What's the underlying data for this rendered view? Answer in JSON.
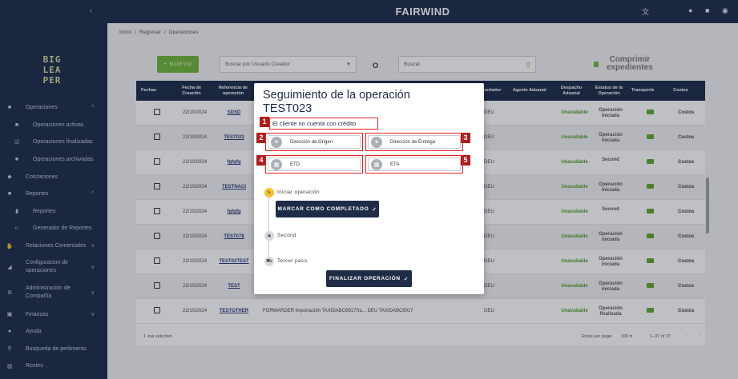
{
  "topbar": {
    "brand": "FAIRWIND",
    "icons": [
      "translate-icon",
      "bell-icon",
      "chat-icon",
      "user-account-icon"
    ]
  },
  "sidebar": {
    "logo_lines": [
      "BIG",
      "LEA",
      "PER"
    ],
    "items": [
      {
        "label": "Operaciones",
        "icon": "folder-icon",
        "chev": "^",
        "sub": false
      },
      {
        "label": "Operaciones activas",
        "icon": "info-icon",
        "sub": true
      },
      {
        "label": "Operaciones finalizadas",
        "icon": "check-box-icon",
        "sub": true
      },
      {
        "label": "Operaciones archivadas",
        "icon": "archive-icon",
        "sub": true
      },
      {
        "label": "Cotizaciones",
        "icon": "tag-icon",
        "sub": false
      },
      {
        "label": "Reportes",
        "icon": "report-icon",
        "chev": "^",
        "sub": false
      },
      {
        "label": "Reportes",
        "icon": "bar-chart-icon",
        "sub": true
      },
      {
        "label": "Generador de Reportes",
        "icon": "code-icon",
        "sub": true
      },
      {
        "label": "Relaciones Comerciales",
        "icon": "handshake-icon",
        "chev": "v",
        "sub": false
      },
      {
        "label": "Configuracion de operaciones",
        "icon": "tools-icon",
        "chev": "v",
        "sub": false,
        "two": true
      },
      {
        "label": "Administración de Compañía",
        "icon": "settings-icon",
        "chev": "v",
        "sub": false,
        "two": true
      },
      {
        "label": "Finanzas",
        "icon": "finance-icon",
        "chev": "v",
        "sub": false
      },
      {
        "label": "Ayuda",
        "icon": "help-icon",
        "sub": false
      },
      {
        "label": "Busqueda de pedimento",
        "icon": "search-icon",
        "sub": false
      },
      {
        "label": "Rostes",
        "icon": "map-icon",
        "sub": false
      }
    ]
  },
  "breadcrumb": {
    "home": "Inicio",
    "sep1": "/",
    "back": "Regresar",
    "sep2": "/",
    "current": "Operaciones"
  },
  "toolbar": {
    "new_label": "+ NUEVO",
    "user_filter_placeholder": "Buscar por Usuario Creador",
    "or_label": "O",
    "search_placeholder": "Buscar",
    "compress_label": "Comprimir expedientes"
  },
  "table": {
    "headers": [
      "Fechas",
      "Fecha de Creación",
      "Referencia de operación",
      "Exportador",
      "Agente Aduanal",
      "Despacho Aduanal",
      "Estatus de la Operación",
      "Transporte",
      "Costos"
    ],
    "rows": [
      {
        "date": "22/10/2024",
        "ref": "SDSD",
        "imp": "DEU",
        "desp": "Unavailable",
        "estado": "Operación iniciada",
        "cost": "Costos"
      },
      {
        "date": "22/10/2024",
        "ref": "TEST023",
        "imp": "DEU",
        "desp": "Unavailable",
        "estado": "Operación iniciada",
        "cost": "Costos"
      },
      {
        "date": "22/10/2024",
        "ref": "fgfgfg",
        "imp": "DEU",
        "desp": "Unavailable",
        "estado": "Second",
        "cost": "Costos"
      },
      {
        "date": "22/10/2024",
        "ref": "TESTNACI",
        "imp": "DEU",
        "desp": "Unavailable",
        "estado": "Operación iniciada",
        "cost": "Costos"
      },
      {
        "date": "22/10/2024",
        "ref": "fgfgfg",
        "imp": "DEU",
        "desp": "Unavailable",
        "estado": "Second",
        "cost": "Costos"
      },
      {
        "date": "22/10/2024",
        "ref": "TEST078",
        "imp": "DEU",
        "desp": "Unavailable",
        "estado": "Operación iniciada",
        "cost": "Costos"
      },
      {
        "date": "22/10/2024",
        "ref": "TEST02TEST",
        "imp": "DEU",
        "desp": "Unavailable",
        "estado": "Operación iniciada",
        "cost": "Costos"
      },
      {
        "date": "22/10/2024",
        "ref": "TEST",
        "imp": "DEU",
        "desp": "Unavailable",
        "estado": "Operación iniciada",
        "cost": "Costos"
      },
      {
        "date": "22/10/2024",
        "ref": "TESTOTHER",
        "extra": "FORWARDER    Importación    TAXIDABC6917Su...      DEU         TAXIDABC6917",
        "imp": "DEU",
        "desp": "Unavailable",
        "estado": "Operación finalizada",
        "cost": "Costos"
      }
    ],
    "footer_selected": "1 row selected",
    "rows_per_page_label": "Rows per page:",
    "rows_per_page_value": "100",
    "range": "1–37 of 37"
  },
  "modal": {
    "title_line1": "Seguimiento de la operación",
    "title_line2": "TEST023",
    "credit_notice": "El cliente no cuenta con crédito",
    "origin_label": "Dirección de Origen",
    "dest_label": "Dirección de Entrega",
    "etd_label": "ETD",
    "eta_label": "ETA",
    "badges": [
      "1",
      "2",
      "3",
      "4",
      "5"
    ],
    "steps": [
      "Iniciar operación",
      "Second",
      "Tercer paso"
    ],
    "complete_btn": "MARCAR COMO COMPLETADO",
    "finish_btn": "FINALIZAR OPERACIÓN",
    "check": "✓"
  }
}
